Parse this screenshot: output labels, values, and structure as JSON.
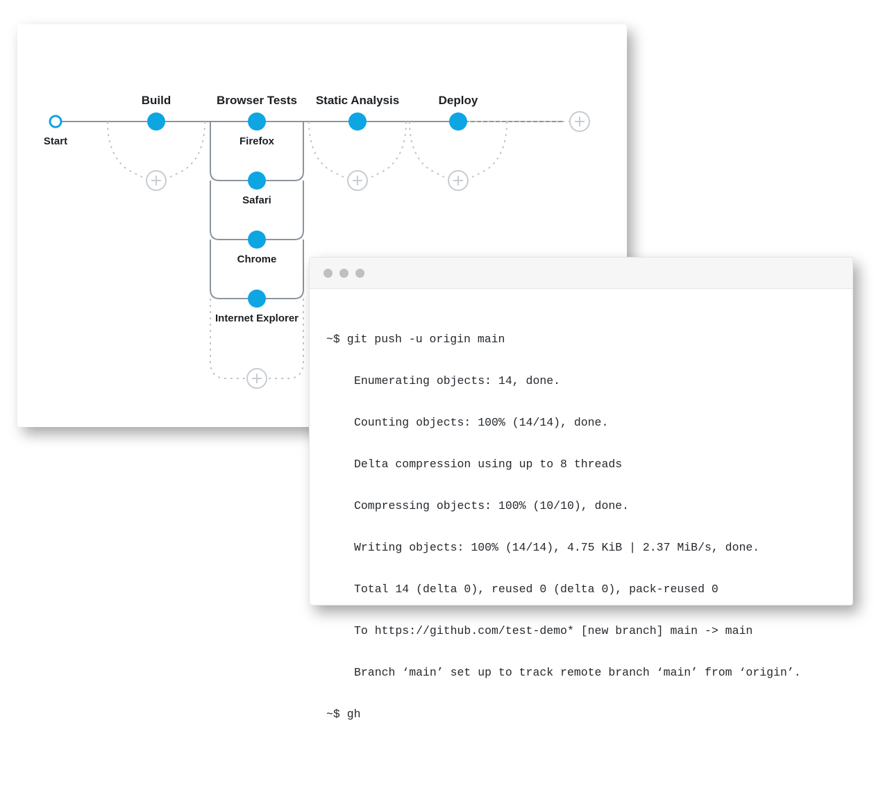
{
  "pipeline": {
    "start_label": "Start",
    "stages": {
      "build": "Build",
      "browser_tests": "Browser Tests",
      "static_analysis": "Static Analysis",
      "deploy": "Deploy"
    },
    "browser_nodes": {
      "firefox": "Firefox",
      "safari": "Safari",
      "chrome": "Chrome",
      "ie": "Internet Explorer"
    }
  },
  "terminal": {
    "prompt1": "~$ git push -u origin main",
    "lines": [
      "Enumerating objects: 14, done.",
      "Counting objects: 100% (14/14), done.",
      "Delta compression using up to 8 threads",
      "Compressing objects: 100% (10/10), done.",
      "Writing objects: 100% (14/14), 4.75 KiB | 2.37 MiB/s, done.",
      "Total 14 (delta 0), reused 0 (delta 0), pack-reused 0",
      "To https://github.com/test-demo* [new branch] main -> main",
      "Branch ‘main’ set up to track remote branch ‘main’ from ‘origin’."
    ],
    "prompt2": "~$ gh"
  },
  "colors": {
    "accent": "#0ea5e3",
    "line": "#8b949e",
    "dotted": "#c0c5cb",
    "plus_circle": "#c7ccd1"
  }
}
